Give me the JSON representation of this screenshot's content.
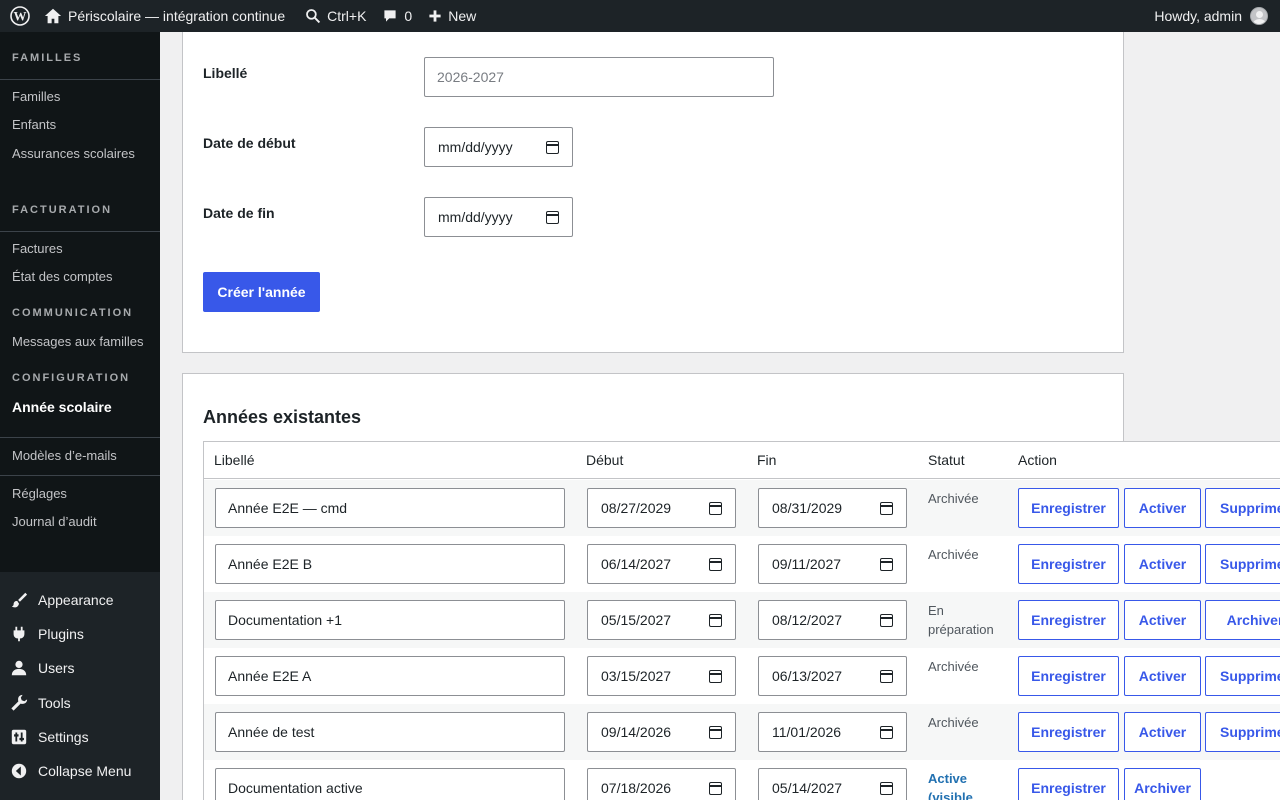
{
  "adminbar": {
    "site_title": "Périscolaire — intégration continue",
    "search_shortcut": "Ctrl+K",
    "comments_count": "0",
    "new_label": "New",
    "howdy": "Howdy, admin"
  },
  "sidebar": {
    "sections": [
      {
        "heading": "FAMILLES",
        "items": [
          "Familles",
          "Enfants",
          "Assurances scolaires"
        ]
      },
      {
        "heading": "FACTURATION",
        "items": [
          "Factures",
          "État des comptes"
        ]
      },
      {
        "heading": "COMMUNICATION",
        "items": [
          "Messages aux familles"
        ]
      },
      {
        "heading": "CONFIGURATION",
        "items": [
          "Année scolaire",
          "Modèles d’e-mails",
          "Réglages",
          "Journal d’audit"
        ]
      }
    ],
    "main_menu": [
      "Appearance",
      "Plugins",
      "Users",
      "Tools",
      "Settings",
      "Collapse Menu"
    ]
  },
  "create_form": {
    "label_field": "Libellé",
    "label_placeholder": "2026-2027",
    "start_field": "Date de début",
    "start_value": "mm/dd/yyyy",
    "end_field": "Date de fin",
    "end_value": "mm/dd/yyyy",
    "submit_label": "Créer l'année"
  },
  "existing": {
    "title": "Années existantes",
    "columns": [
      "Libellé",
      "Début",
      "Fin",
      "Statut",
      "Action"
    ],
    "rows": [
      {
        "label": "Année E2E — cmd",
        "start": "08/27/2029",
        "end": "08/31/2029",
        "status": "Archivée",
        "actions": [
          "Enregistrer",
          "Activer",
          "Supprimer"
        ]
      },
      {
        "label": "Année E2E B",
        "start": "06/14/2027",
        "end": "09/11/2027",
        "status": "Archivée",
        "actions": [
          "Enregistrer",
          "Activer",
          "Supprimer"
        ]
      },
      {
        "label": "Documentation +1",
        "start": "05/15/2027",
        "end": "08/12/2027",
        "status": "En préparation",
        "actions": [
          "Enregistrer",
          "Activer",
          "Archiver"
        ]
      },
      {
        "label": "Année E2E A",
        "start": "03/15/2027",
        "end": "06/13/2027",
        "status": "Archivée",
        "actions": [
          "Enregistrer",
          "Activer",
          "Supprimer"
        ]
      },
      {
        "label": "Année de test",
        "start": "09/14/2026",
        "end": "11/01/2026",
        "status": "Archivée",
        "actions": [
          "Enregistrer",
          "Activer",
          "Supprimer"
        ]
      },
      {
        "label": "Documentation active",
        "start": "07/18/2026",
        "end": "05/14/2027",
        "status": "Active (visible",
        "actions": [
          "Enregistrer",
          "Archiver"
        ]
      }
    ]
  },
  "colors": {
    "accent": "#3858e9",
    "adminbar": "#1d2327",
    "active_status": "#2271b1"
  }
}
